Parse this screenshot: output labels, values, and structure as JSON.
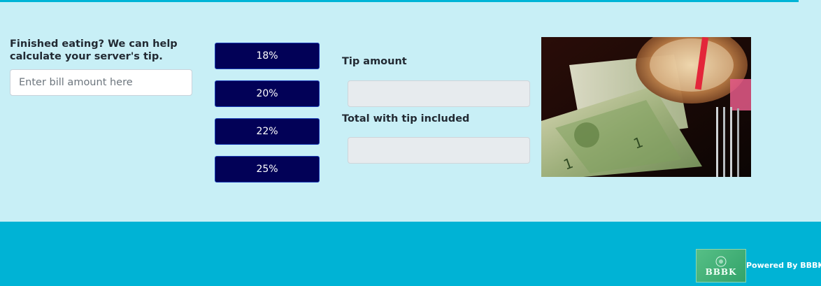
{
  "calculator": {
    "prompt": "Finished eating? We can help calculate your server's tip.",
    "bill_placeholder": "Enter bill amount here",
    "bill_value": "",
    "tip_options": [
      "18%",
      "20%",
      "22%",
      "25%"
    ],
    "tip_amount_label": "Tip amount",
    "tip_amount_value": "",
    "total_label": "Total with tip included",
    "total_value": ""
  },
  "photo": {
    "subject": "dollar-bills-and-drink-photo"
  },
  "footer": {
    "logo_text": "BBBK",
    "powered_text": "Powered By BBBK"
  },
  "colors": {
    "top_bar": "#00b4d6",
    "panel": "#c8eff6",
    "button": "#020157",
    "footer": "#00b3d5"
  }
}
